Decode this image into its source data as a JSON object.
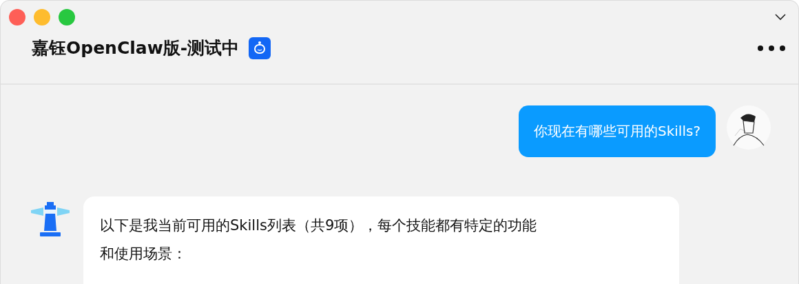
{
  "window": {
    "title": "嘉钰OpenClaw版-测试中"
  },
  "messages": [
    {
      "kind": "user",
      "text": "你现在有哪些可用的Skills?"
    },
    {
      "kind": "bot",
      "text": "以下是我当前可用的Skills列表（共9项），每个技能都有特定的功能和使用场景："
    }
  ]
}
